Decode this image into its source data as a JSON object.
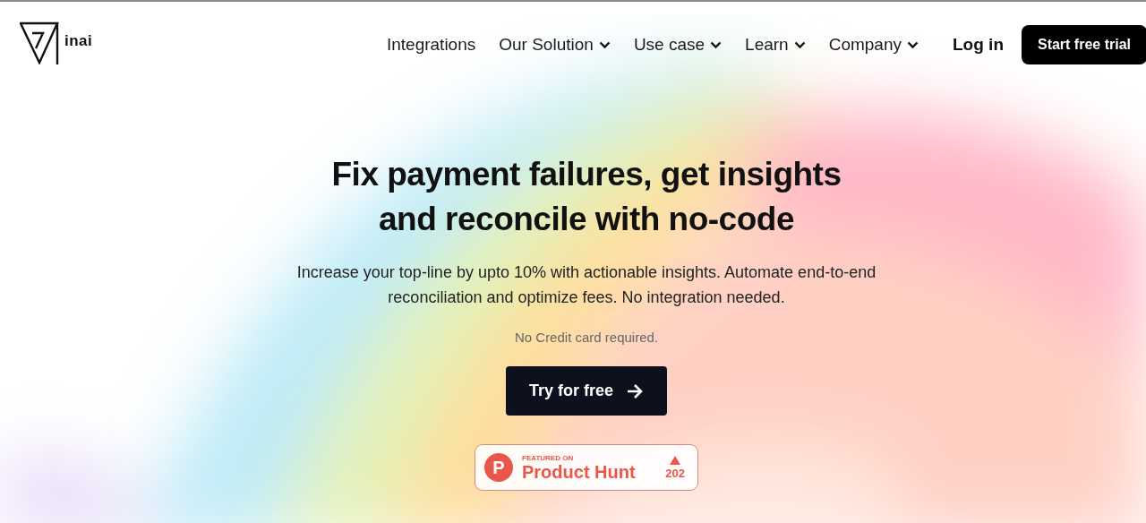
{
  "logo": {
    "text": "inai"
  },
  "nav": [
    {
      "label": "Integrations",
      "has_menu": false
    },
    {
      "label": "Our Solution",
      "has_menu": true
    },
    {
      "label": "Use case",
      "has_menu": true
    },
    {
      "label": "Learn",
      "has_menu": true
    },
    {
      "label": "Company",
      "has_menu": true
    }
  ],
  "login": "Log in",
  "cta_top": "Start free trial",
  "hero": {
    "title": "Fix payment failures, get insights and reconcile with no-code",
    "subtitle": "Increase your top-line by upto 10% with actionable insights. Automate end-to-end reconciliation and optimize fees. No integration needed.",
    "note": "No Credit card required.",
    "button": "Try for free"
  },
  "badge": {
    "letter": "P",
    "eyebrow": "FEATURED ON",
    "name": "Product Hunt",
    "votes": "202"
  }
}
